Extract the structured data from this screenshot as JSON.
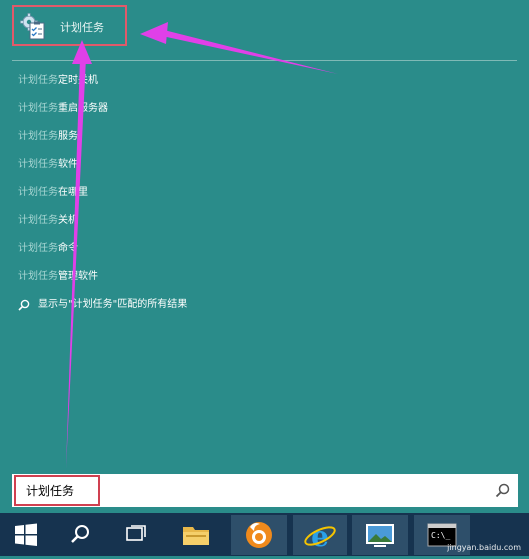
{
  "top_result": {
    "label": "计划任务"
  },
  "suggestions": [
    {
      "query": "计划任务",
      "rest": "定时关机"
    },
    {
      "query": "计划任务",
      "rest": "重启服务器"
    },
    {
      "query": "计划任务",
      "rest": "服务"
    },
    {
      "query": "计划任务",
      "rest": "软件"
    },
    {
      "query": "计划任务",
      "rest": "在哪里"
    },
    {
      "query": "计划任务",
      "rest": "关机"
    },
    {
      "query": "计划任务",
      "rest": "命令"
    },
    {
      "query": "计划任务",
      "rest": "管理软件"
    }
  ],
  "search_all": {
    "text": "显示与\"计划任务\"匹配的所有结果"
  },
  "search_box": {
    "value": "计划任务"
  },
  "watermark": {
    "text": "jingyan.baidu.com"
  },
  "icons": {
    "app": "task-scheduler-icon",
    "search": "magnifier-icon",
    "start": "windows-logo-icon",
    "task_view": "task-view-icon",
    "explorer": "folder-icon",
    "uc": "uc-browser-icon",
    "ie": "internet-explorer-icon",
    "photos": "photo-viewer-icon",
    "cmd": "command-prompt-icon"
  },
  "colors": {
    "background": "#2a8c8a",
    "taskbar": "#16334f",
    "highlight_border": "#e05a6a",
    "arrow": "#e040e8",
    "query_text": "#a8d6d3"
  }
}
